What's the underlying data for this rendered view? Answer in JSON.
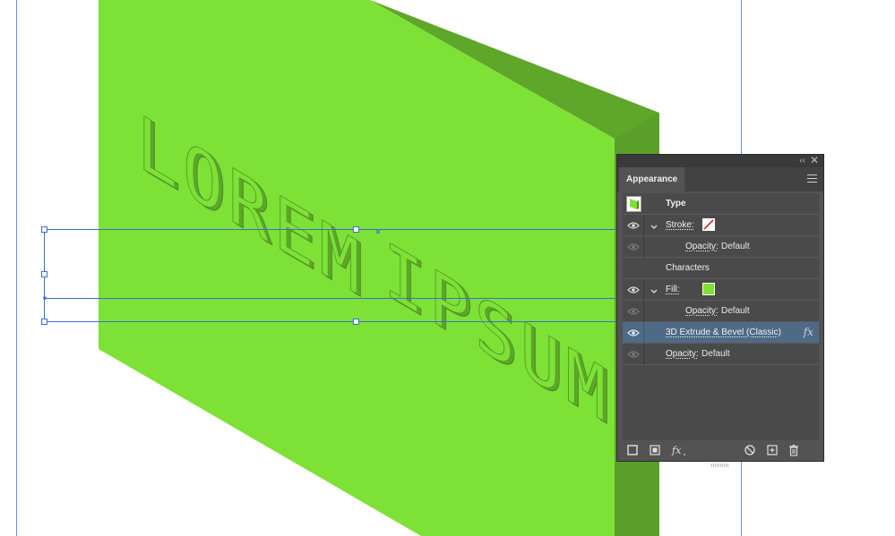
{
  "canvas": {
    "artwork_text": {
      "line1": "LOREM",
      "line2": "IPSUM"
    },
    "colors": {
      "front_face": "#7de136",
      "side_face": "#5fa72b",
      "side_dark": "#4f8e24",
      "guide": "#6b8fd6",
      "selection": "#3a6fd4"
    }
  },
  "appearance_panel": {
    "title": "Appearance",
    "colors": {
      "panel_bg": "#535353",
      "selected_row": "#4e6a86",
      "fill_swatch": "#7de136",
      "stroke_swatch": "#ffffff"
    },
    "rows": {
      "type": {
        "label": "Type"
      },
      "stroke": {
        "label": "Stroke:"
      },
      "stroke_opacity": {
        "label": "Opacity:",
        "value": "Default"
      },
      "characters": {
        "label": "Characters"
      },
      "fill": {
        "label": "Fill:"
      },
      "fill_opacity": {
        "label": "Opacity:",
        "value": "Default"
      },
      "effect": {
        "label": "3D Extrude & Bevel (Classic)",
        "icon": "fx-icon"
      },
      "opacity": {
        "label": "Opacity:",
        "value": "Default"
      }
    },
    "footer_icons": [
      "add-stroke-icon",
      "add-fill-icon",
      "add-effect-icon",
      "clear-appearance-icon",
      "duplicate-item-icon",
      "delete-item-icon"
    ]
  }
}
